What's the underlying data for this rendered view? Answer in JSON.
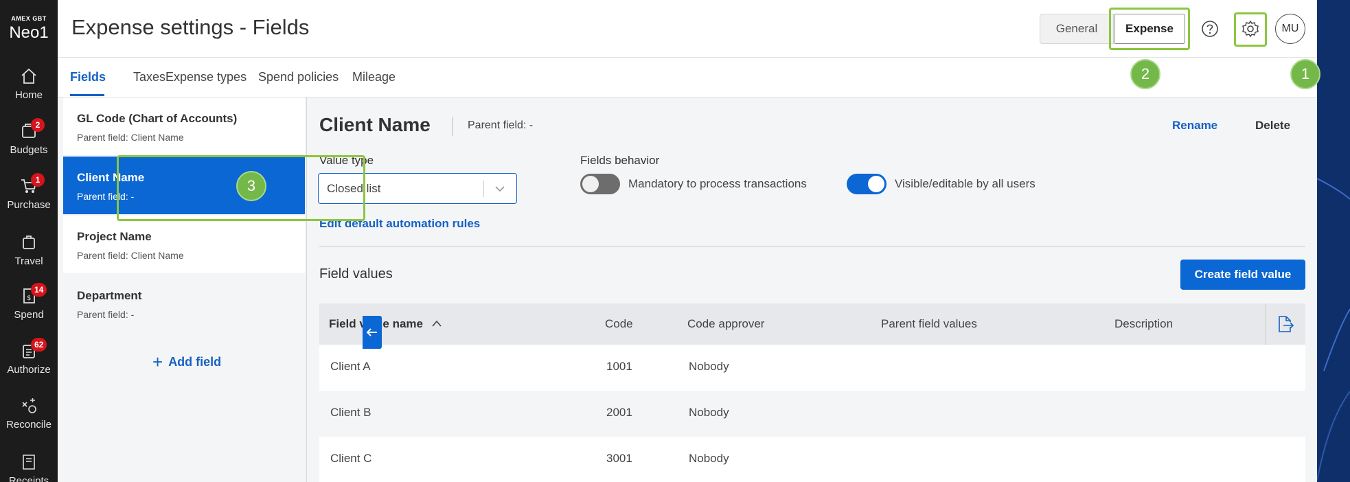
{
  "brand": {
    "small": "AMEX GBT",
    "big": "Neo1"
  },
  "nav": [
    {
      "label": "Home",
      "icon": "home-icon",
      "badge": ""
    },
    {
      "label": "Budgets",
      "icon": "budgets-icon",
      "badge": "2"
    },
    {
      "label": "Purchase",
      "icon": "cart-icon",
      "badge": "1"
    },
    {
      "label": "Travel",
      "icon": "suitcase-icon",
      "badge": ""
    },
    {
      "label": "Spend",
      "icon": "spend-icon",
      "badge": "14"
    },
    {
      "label": "Authorize",
      "icon": "clipboard-icon",
      "badge": "62"
    },
    {
      "label": "Reconcile",
      "icon": "reconcile-icon",
      "badge": ""
    },
    {
      "label": "Receipts",
      "icon": "receipts-icon",
      "badge": ""
    }
  ],
  "header": {
    "title": "Expense settings - Fields",
    "segments": {
      "general": "General",
      "expense": "Expense"
    },
    "avatar": "MU"
  },
  "callouts": {
    "one": "1",
    "two": "2",
    "three": "3"
  },
  "tabs": [
    "Fields",
    "Taxes",
    "Expense types",
    "Spend policies",
    "Mileage"
  ],
  "fields": [
    {
      "name": "GL Code (Chart of Accounts)",
      "parent": "Parent field:  Client Name"
    },
    {
      "name": "Client Name",
      "parent": "Parent field:  -"
    },
    {
      "name": "Project Name",
      "parent": "Parent field:  Client Name"
    },
    {
      "name": "Department",
      "parent": "Parent field:  -"
    }
  ],
  "add_field": "Add field",
  "detail": {
    "title": "Client Name",
    "parent": "Parent field:  -",
    "rename": "Rename",
    "delete": "Delete",
    "value_type_label": "Value type",
    "value_type": "Closed list",
    "fields_behavior_label": "Fields behavior",
    "toggle_mandatory": "Mandatory to process transactions",
    "toggle_visible": "Visible/editable by all users",
    "mandatory_on": false,
    "visible_on": true,
    "edit_rules": "Edit default automation rules",
    "field_values_title": "Field values",
    "create_button": "Create field value"
  },
  "table": {
    "columns": [
      "Field value name",
      "Code",
      "Code approver",
      "Parent field values",
      "Description"
    ],
    "rows": [
      [
        "Client A",
        "1001",
        "Nobody",
        "",
        ""
      ],
      [
        "Client B",
        "2001",
        "Nobody",
        "",
        ""
      ],
      [
        "Client C",
        "3001",
        "Nobody",
        "",
        ""
      ]
    ]
  },
  "colors": {
    "accent": "#0a67d4",
    "highlight": "#8cc63f",
    "badge": "#d6141b",
    "rail": "#1c1c1c"
  }
}
